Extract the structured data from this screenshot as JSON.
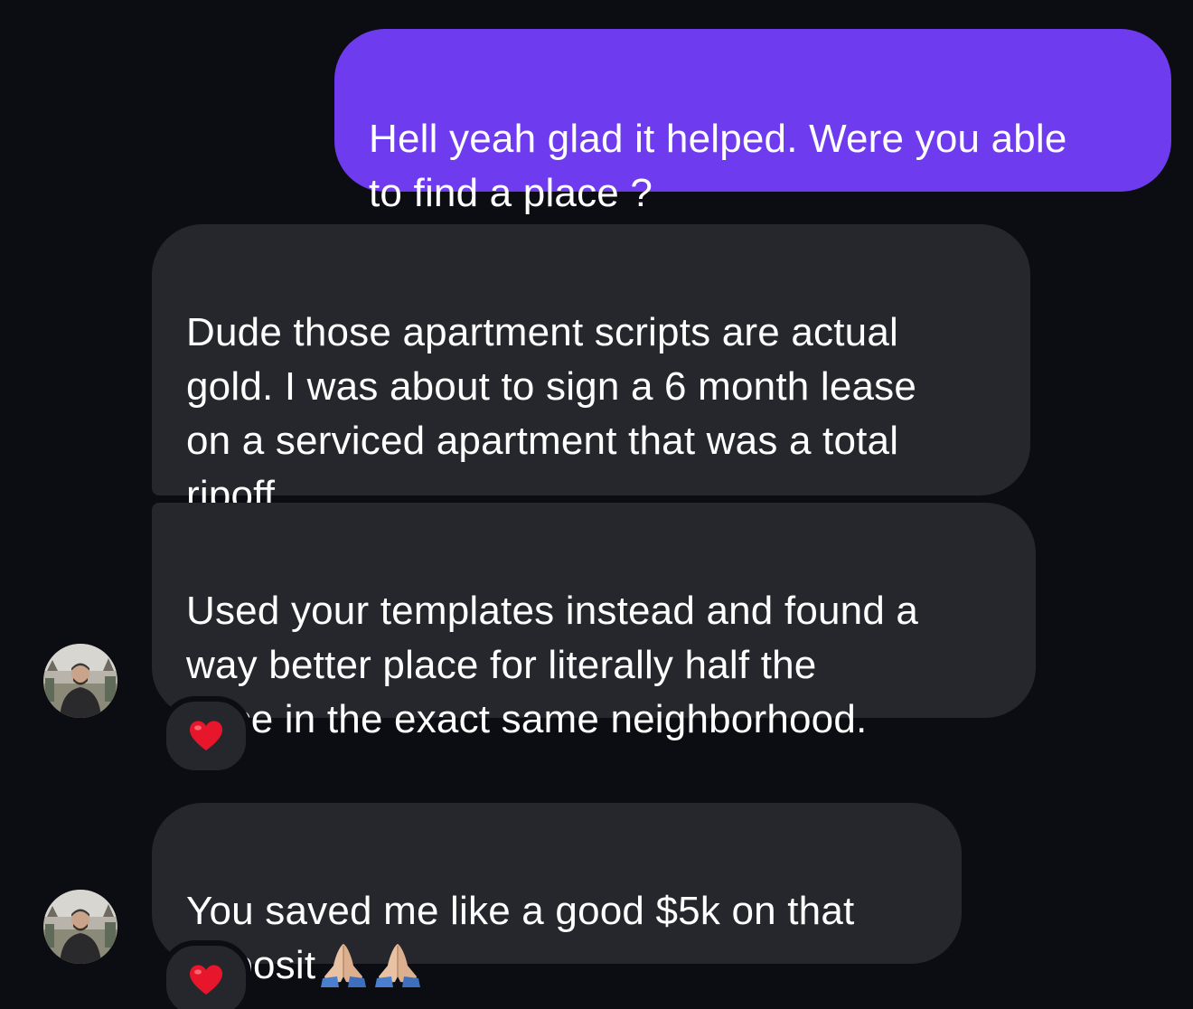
{
  "conversation": {
    "messages": [
      {
        "direction": "outgoing",
        "text": "Hell yeah glad it helped. Were you able\nto find a place ?"
      },
      {
        "direction": "incoming",
        "text": "Dude those apartment scripts are actual\ngold. I was about to sign a 6 month lease\non a serviced apartment that was a total\nripoff."
      },
      {
        "direction": "incoming",
        "text": "Used your templates instead and found a\nway better place for literally half the\nprice in the exact same neighborhood.",
        "reaction": "heart-icon"
      },
      {
        "direction": "incoming",
        "text": "You saved me like a good $5k on that\ndeposit",
        "emojis": [
          "folded-hands-icon",
          "folded-hands-icon"
        ],
        "reaction": "heart-icon"
      }
    ]
  },
  "theme": {
    "background": "#0b0d12",
    "outgoing_bubble": "#6f3bef",
    "incoming_bubble": "#25272c",
    "reaction_heart": "#e8162b"
  }
}
